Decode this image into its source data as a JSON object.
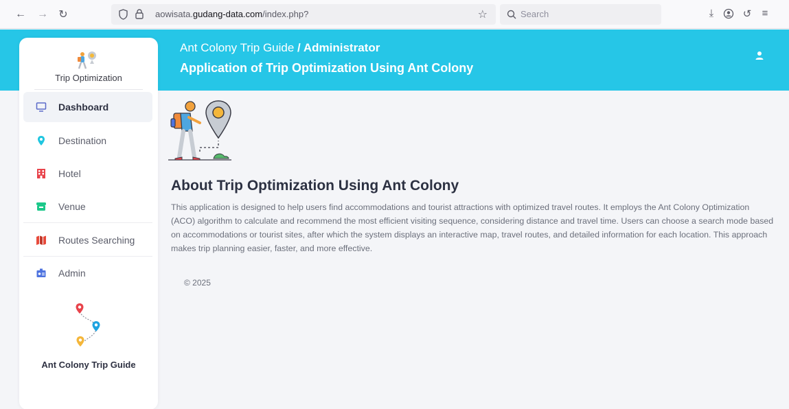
{
  "browser": {
    "url_prefix": "aowisata.",
    "url_host": "gudang-data.com",
    "url_path": "/index.php?",
    "search_placeholder": "Search"
  },
  "sidebar": {
    "brand_name": "Trip Optimization",
    "items": [
      {
        "label": "Dashboard",
        "icon": "monitor-icon",
        "active": true
      },
      {
        "label": "Destination",
        "icon": "map-pin-icon",
        "active": false
      },
      {
        "label": "Hotel",
        "icon": "hotel-icon",
        "active": false
      },
      {
        "label": "Venue",
        "icon": "venue-icon",
        "active": false
      },
      {
        "label": "Routes Searching",
        "icon": "map-icon",
        "active": false
      },
      {
        "label": "Admin",
        "icon": "admin-icon",
        "active": false
      }
    ],
    "footer_name": "Ant Colony Trip Guide"
  },
  "header": {
    "site_name": "Ant Colony Trip Guide",
    "separator": " / ",
    "role": "Administrator",
    "subtitle": "Application of Trip Optimization Using Ant Colony"
  },
  "main": {
    "title": "About Trip Optimization Using Ant Colony",
    "description": "This application is designed to help users find accommodations and tourist attractions with optimized travel routes. It employs the Ant Colony Optimization (ACO) algorithm to calculate and recommend the most efficient visiting sequence, considering distance and travel time. Users can choose a search mode based on accommodations or tourist sites, after which the system displays an interactive map, travel routes, and detailed information for each location. This approach makes trip planning easier, faster, and more effective.",
    "copyright": "© 2025"
  },
  "colors": {
    "header": "#26c6e7",
    "active_item_bg": "#f1f3f7"
  }
}
